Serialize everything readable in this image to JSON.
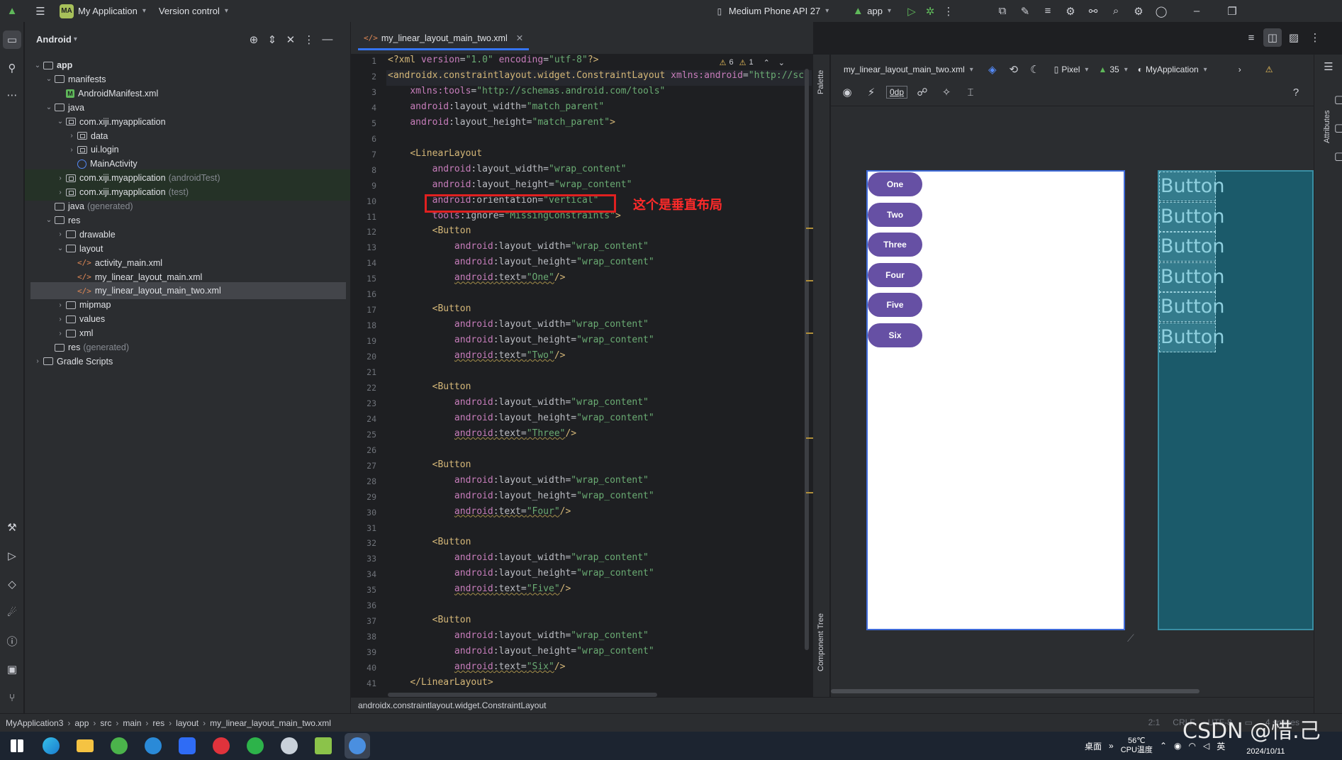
{
  "title_bar": {
    "app_badge": "MA",
    "project": "My Application",
    "vcs": "Version control",
    "device": "Medium Phone API 27",
    "run_config": "app"
  },
  "project_panel": {
    "view": "Android",
    "items": [
      {
        "label": "app",
        "suffix": "",
        "icon": "module"
      },
      {
        "label": "manifests",
        "suffix": "",
        "icon": "folder"
      },
      {
        "label": "AndroidManifest.xml",
        "suffix": "",
        "icon": "manifest"
      },
      {
        "label": "java",
        "suffix": "",
        "icon": "folder"
      },
      {
        "label": "com.xiji.myapplication",
        "suffix": "",
        "icon": "package"
      },
      {
        "label": "data",
        "suffix": "",
        "icon": "package"
      },
      {
        "label": "ui.login",
        "suffix": "",
        "icon": "package"
      },
      {
        "label": "MainActivity",
        "suffix": "",
        "icon": "class"
      },
      {
        "label": "com.xiji.myapplication",
        "suffix": "(androidTest)",
        "icon": "package"
      },
      {
        "label": "com.xiji.myapplication",
        "suffix": "(test)",
        "icon": "package"
      },
      {
        "label": "java",
        "suffix": "(generated)",
        "icon": "folder"
      },
      {
        "label": "res",
        "suffix": "",
        "icon": "folder"
      },
      {
        "label": "drawable",
        "suffix": "",
        "icon": "folder"
      },
      {
        "label": "layout",
        "suffix": "",
        "icon": "folder"
      },
      {
        "label": "activity_main.xml",
        "suffix": "",
        "icon": "xml"
      },
      {
        "label": "my_linear_layout_main.xml",
        "suffix": "",
        "icon": "xml"
      },
      {
        "label": "my_linear_layout_main_two.xml",
        "suffix": "",
        "icon": "xml"
      },
      {
        "label": "mipmap",
        "suffix": "",
        "icon": "folder"
      },
      {
        "label": "values",
        "suffix": "",
        "icon": "folder"
      },
      {
        "label": "xml",
        "suffix": "",
        "icon": "folder"
      },
      {
        "label": "res",
        "suffix": "(generated)",
        "icon": "folder"
      },
      {
        "label": "Gradle Scripts",
        "suffix": "",
        "icon": "gradle"
      }
    ]
  },
  "editor": {
    "tab": "my_linear_layout_main_two.xml",
    "warnings": "6",
    "weak_warnings": "1",
    "line_numbers": [
      "1",
      "2",
      "3",
      "4",
      "5",
      "6",
      "7",
      "8",
      "9",
      "10",
      "11",
      "12",
      "13",
      "14",
      "15",
      "16",
      "17",
      "18",
      "19",
      "20",
      "21",
      "22",
      "23",
      "24",
      "25",
      "26",
      "27",
      "28",
      "29",
      "30",
      "31",
      "32",
      "33",
      "34",
      "35",
      "36",
      "37",
      "38",
      "39",
      "40",
      "41"
    ],
    "annotation": "这个是垂直布局"
  },
  "design": {
    "file": "my_linear_layout_main_two.xml",
    "device": "Pixel",
    "api": "35",
    "theme": "MyApplication",
    "margin": "0dp",
    "palette": "Palette",
    "component_tree": "Component Tree",
    "attributes": "Attributes",
    "buttons": [
      "One",
      "Two",
      "Three",
      "Four",
      "Five",
      "Six"
    ],
    "blueprint_label": "Button"
  },
  "status": {
    "element_path": "androidx.constraintlayout.widget.ConstraintLayout",
    "crumbs": [
      "MyApplication3",
      "app",
      "src",
      "main",
      "res",
      "layout",
      "my_linear_layout_main_two.xml"
    ],
    "position": "2:1",
    "line_sep": "CRLF",
    "encoding": "UTF-8",
    "indent": "4 spaces"
  },
  "taskbar": {
    "desktop": "桌面",
    "temp": "56℃",
    "temp_label": "CPU温度",
    "ime": "英",
    "date": "2024/10/11",
    "watermark": "CSDN @惜.己"
  }
}
